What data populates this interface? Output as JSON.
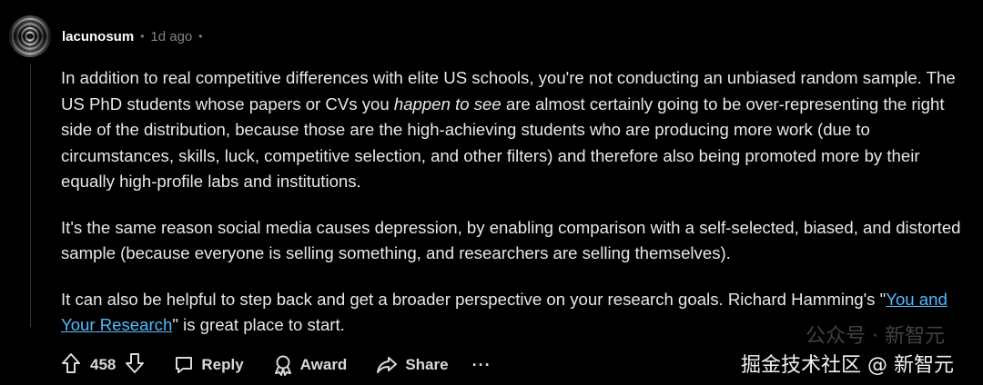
{
  "comment": {
    "username": "lacunosum",
    "separator_1": "•",
    "timestamp": "1d ago",
    "separator_2": "•",
    "paragraphs": {
      "p1_before_em": "In addition to real competitive differences with elite US schools, you're not conducting an unbiased random sample. The US PhD students whose papers or CVs you ",
      "p1_em": "happen to see",
      "p1_after_em": " are almost certainly going to be over-representing the right side of the distribution, because those are the high-achieving students who are producing more work (due to circumstances, skills, luck, competitive selection, and other filters) and therefore also being promoted more by their equally high-profile labs and institutions.",
      "p2": "It's the same reason social media causes depression, by enabling comparison with a self-selected, biased, and distorted sample (because everyone is selling something, and researchers are selling themselves).",
      "p3_before_link": "It can also be helpful to step back and get a broader perspective on your research goals. Richard Hamming's \"",
      "p3_link": "You and Your Research",
      "p3_after_link": "\" is great place to start."
    }
  },
  "actions": {
    "vote_count": "458",
    "reply_label": "Reply",
    "award_label": "Award",
    "share_label": "Share",
    "more_label": "···"
  },
  "watermark": {
    "faint": "公众号 · 新智元",
    "main": "掘金技术社区 @ 新智元"
  }
}
